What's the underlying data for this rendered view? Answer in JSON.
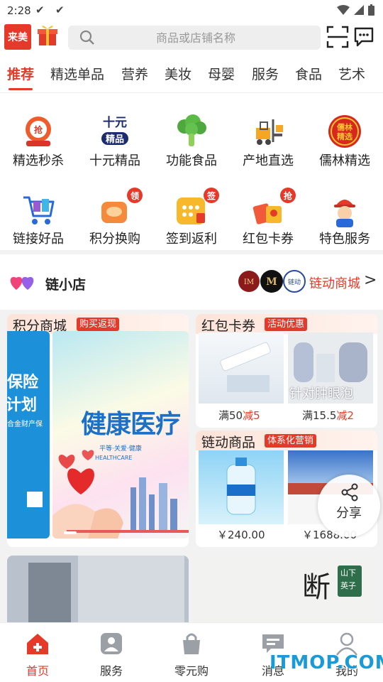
{
  "status_bar": {
    "time": "2:28"
  },
  "header": {
    "logo_text": "来美",
    "search_placeholder": "商品或店铺名称"
  },
  "tabs": [
    "推荐",
    "精选单品",
    "营养",
    "美妆",
    "母婴",
    "服务",
    "食品",
    "艺术"
  ],
  "grid": [
    {
      "label": "精选秒杀",
      "icon": "flash-sale-icon"
    },
    {
      "label": "十元精品",
      "icon": "ten-yuan-icon",
      "icon_text": [
        "十元",
        "精品"
      ]
    },
    {
      "label": "功能食品",
      "icon": "broccoli-icon"
    },
    {
      "label": "产地直选",
      "icon": "forklift-icon"
    },
    {
      "label": "儒林精选",
      "icon": "rulin-seal-icon",
      "icon_text": [
        "儒林",
        "精选"
      ]
    },
    {
      "label": "链接好品",
      "icon": "shopping-cart-icon"
    },
    {
      "label": "积分换购",
      "icon": "points-exchange-icon",
      "badge": "领"
    },
    {
      "label": "签到返利",
      "icon": "calendar-icon",
      "badge": "签"
    },
    {
      "label": "红包卡券",
      "icon": "red-packet-icon",
      "badge": "抢"
    },
    {
      "label": "特色服务",
      "icon": "worker-icon"
    }
  ],
  "shop": {
    "title": "链小店",
    "link": "链动商城",
    "arrow": ">",
    "logo_texts": [
      "IM",
      "M",
      "链动"
    ]
  },
  "cards": {
    "points": {
      "title": "积分商城",
      "tag": "购买返现",
      "banner_left_texts": [
        "保险",
        "计划",
        "合金财产保"
      ],
      "banner_main_text": "健康医疗",
      "banner_sub_texts": [
        "平等·关爱·健康",
        "HEALTHCARE"
      ]
    },
    "coupons": {
      "title": "红包卡券",
      "tag": "活动优惠",
      "items": [
        {
          "price": "满50",
          "minus": "减5"
        },
        {
          "price": "满15.5",
          "minus": "减2",
          "image_text": "针对肿眼泡"
        }
      ]
    },
    "chain": {
      "title": "链动商品",
      "tag": "体系化营销",
      "items": [
        {
          "price": "￥240.00"
        },
        {
          "price": "￥1688.00"
        }
      ]
    },
    "bottom_right_texts": [
      "断",
      "山下",
      "英子"
    ]
  },
  "share": {
    "label": "分享"
  },
  "bottom_nav": [
    {
      "label": "首页",
      "icon": "home-icon",
      "active": true
    },
    {
      "label": "服务",
      "icon": "service-icon",
      "active": false
    },
    {
      "label": "零元购",
      "icon": "bag-icon",
      "active": false
    },
    {
      "label": "消息",
      "icon": "message-icon",
      "active": false
    },
    {
      "label": "我的",
      "icon": "profile-icon",
      "active": false
    }
  ],
  "watermark": "ITMOP.COM",
  "colors": {
    "accent": "#e53a2a",
    "watermark": "#1a9ad6"
  }
}
